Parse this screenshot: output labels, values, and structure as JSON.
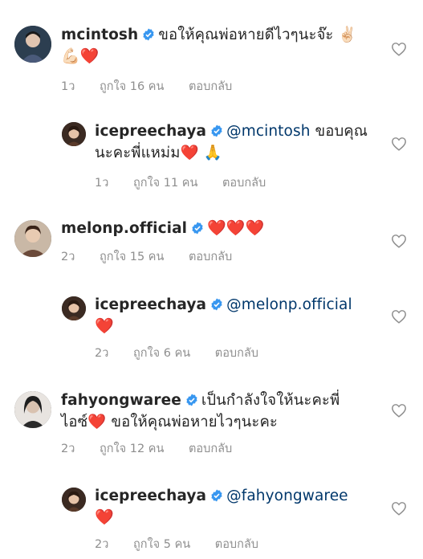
{
  "comments": [
    {
      "username": "mcintosh",
      "text_line1": "ขอให้คุณพ่อหายดีไวๆนะจ๊ะ ✌🏻",
      "text_line2": "💪🏻❤️",
      "time": "1ว",
      "likes": "ถูกใจ 16 คน",
      "reply": "ตอบกลับ"
    },
    {
      "username": "icepreechaya",
      "mention": "@mcintosh",
      "text_line1": " ขอบคุณ",
      "text_line2": "นะคะพี่แหม่ม❤️ 🙏",
      "time": "1ว",
      "likes": "ถูกใจ 11 คน",
      "reply": "ตอบกลับ"
    },
    {
      "username": "melonp.official",
      "text_line1": "❤️❤️❤️",
      "time": "2ว",
      "likes": "ถูกใจ 15 คน",
      "reply": "ตอบกลับ"
    },
    {
      "username": "icepreechaya",
      "mention": "@melonp.official",
      "text_line2": "❤️",
      "time": "2ว",
      "likes": "ถูกใจ 6 คน",
      "reply": "ตอบกลับ"
    },
    {
      "username": "fahyongwaree",
      "text_line1": "เป็นกำลังใจให้นะคะพี่",
      "text_line2": "ไอซ์❤️ ขอให้คุณพ่อหายไวๆนะคะ",
      "time": "2ว",
      "likes": "ถูกใจ 12 คน",
      "reply": "ตอบกลับ"
    },
    {
      "username": "icepreechaya",
      "mention": "@fahyongwaree",
      "text_line2": "❤️",
      "time": "2ว",
      "likes": "ถูกใจ 5 คน",
      "reply": "ตอบกลับ"
    }
  ],
  "colors": {
    "verified": "#3897f0",
    "mention": "#00376b",
    "meta": "#8e8e8e"
  },
  "icons": {
    "verified": "verified-badge-icon",
    "like": "heart-outline-icon"
  }
}
